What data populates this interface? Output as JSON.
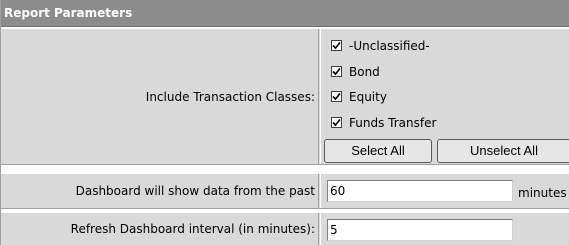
{
  "section": {
    "title": "Report Parameters"
  },
  "transaction_classes": {
    "label": "Include Transaction Classes:",
    "options": [
      {
        "label": "-Unclassified-",
        "checked": true
      },
      {
        "label": "Bond",
        "checked": true
      },
      {
        "label": "Equity",
        "checked": true
      },
      {
        "label": "Funds Transfer",
        "checked": true
      }
    ],
    "select_all_label": "Select All",
    "unselect_all_label": "Unselect All"
  },
  "dashboard_range": {
    "label": "Dashboard will show data from the past",
    "value": "60",
    "unit": "minutes"
  },
  "refresh_interval": {
    "label": "Refresh Dashboard interval (in minutes):",
    "value": "5"
  }
}
